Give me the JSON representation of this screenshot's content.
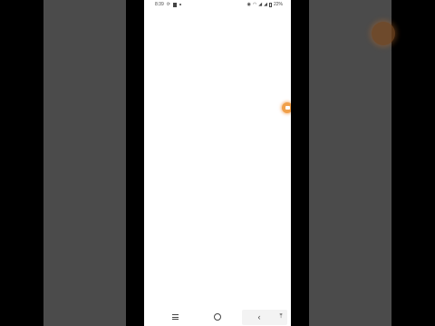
{
  "status_bar": {
    "time": "8:39",
    "battery_percent": "22%",
    "left_icons": [
      "sync-icon",
      "gallery-icon",
      "dot-icon"
    ],
    "right_icons": [
      "eye-icon",
      "wifi-icon",
      "signal-icon",
      "signal-icon",
      "battery-icon"
    ]
  },
  "floating_bubble": {
    "color": "#f0a04a",
    "icon": "bubble-icon"
  },
  "nav_bar": {
    "menu_icon": "hamburger-icon",
    "home_icon": "home-circle-icon",
    "back_icon": "back-chevron-icon",
    "extra_icon": "pin-icon"
  },
  "colors": {
    "background": "#000000",
    "side_panels": "#4b4b4b",
    "screen": "#ffffff",
    "accent": "#f0a04a"
  }
}
